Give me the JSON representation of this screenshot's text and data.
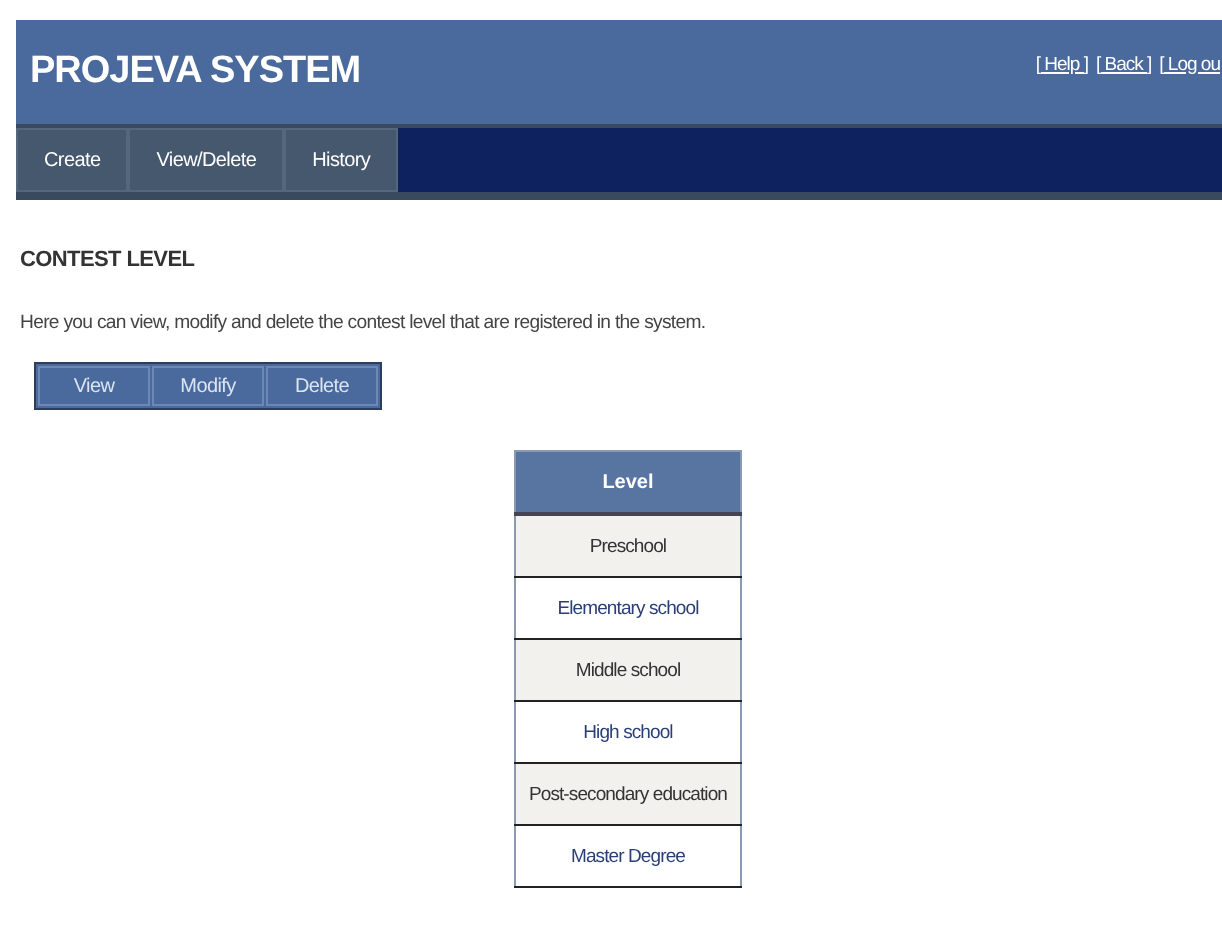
{
  "header": {
    "title": "PROJEVA SYSTEM",
    "links": [
      "[ Help ]",
      "[ Back ]",
      "[ Log ou"
    ]
  },
  "nav": [
    {
      "label": "Create"
    },
    {
      "label": "View/Delete"
    },
    {
      "label": "History"
    }
  ],
  "page": {
    "heading": "CONTEST LEVEL",
    "description": "Here you can view, modify and delete the contest level that are registered in the system."
  },
  "actions": [
    "View",
    "Modify",
    "Delete"
  ],
  "table": {
    "columns": [
      "Level"
    ],
    "rows": [
      "Preschool",
      "Elementary school",
      "Middle school",
      "High school",
      "Post-secondary education",
      "Master Degree"
    ]
  }
}
